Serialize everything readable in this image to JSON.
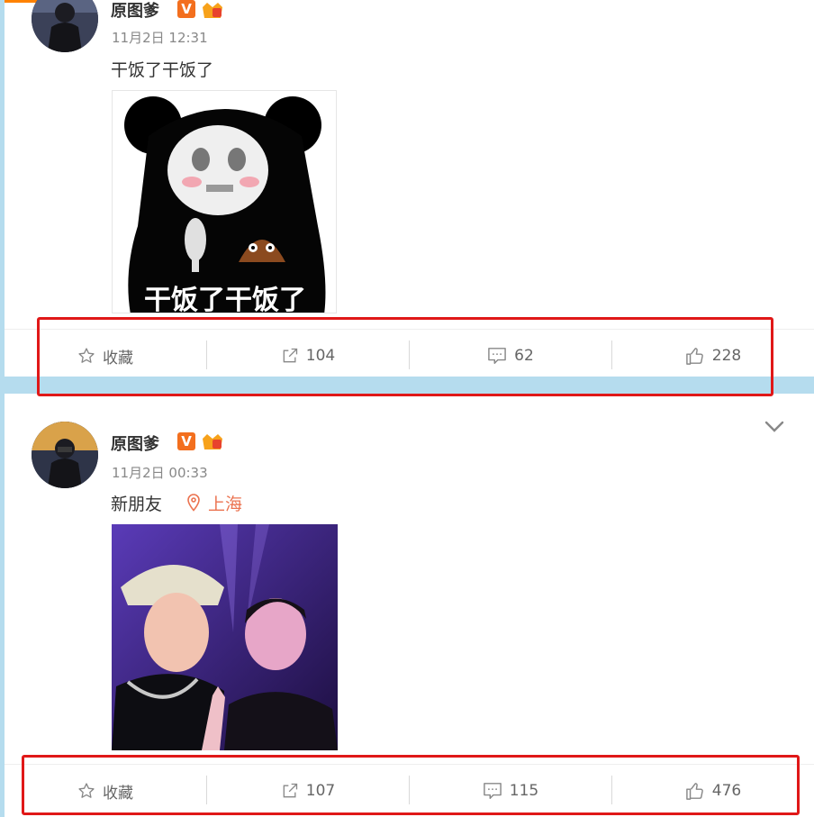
{
  "posts": [
    {
      "username": "原图爹",
      "verified_badge": "V",
      "time": "11月2日 12:31",
      "text": "干饭了干饭了",
      "media_caption": "干饭了干饭了",
      "actions": {
        "favorite": "收藏",
        "repost": "104",
        "comment": "62",
        "like": "228"
      }
    },
    {
      "username": "原图爹",
      "verified_badge": "V",
      "time": "11月2日 00:33",
      "text": "新朋友",
      "location": "上海",
      "actions": {
        "favorite": "收藏",
        "repost": "107",
        "comment": "115",
        "like": "476"
      }
    }
  ],
  "icons": {
    "favorite": "star-icon",
    "repost": "share-icon",
    "comment": "comment-icon",
    "like": "thumbs-up-icon",
    "collapse": "chevron-down-icon",
    "location": "location-pin-icon"
  },
  "colors": {
    "background": "#b5dcee",
    "accent": "#ff8200",
    "location": "#eb7350",
    "highlight": "#e01818"
  }
}
